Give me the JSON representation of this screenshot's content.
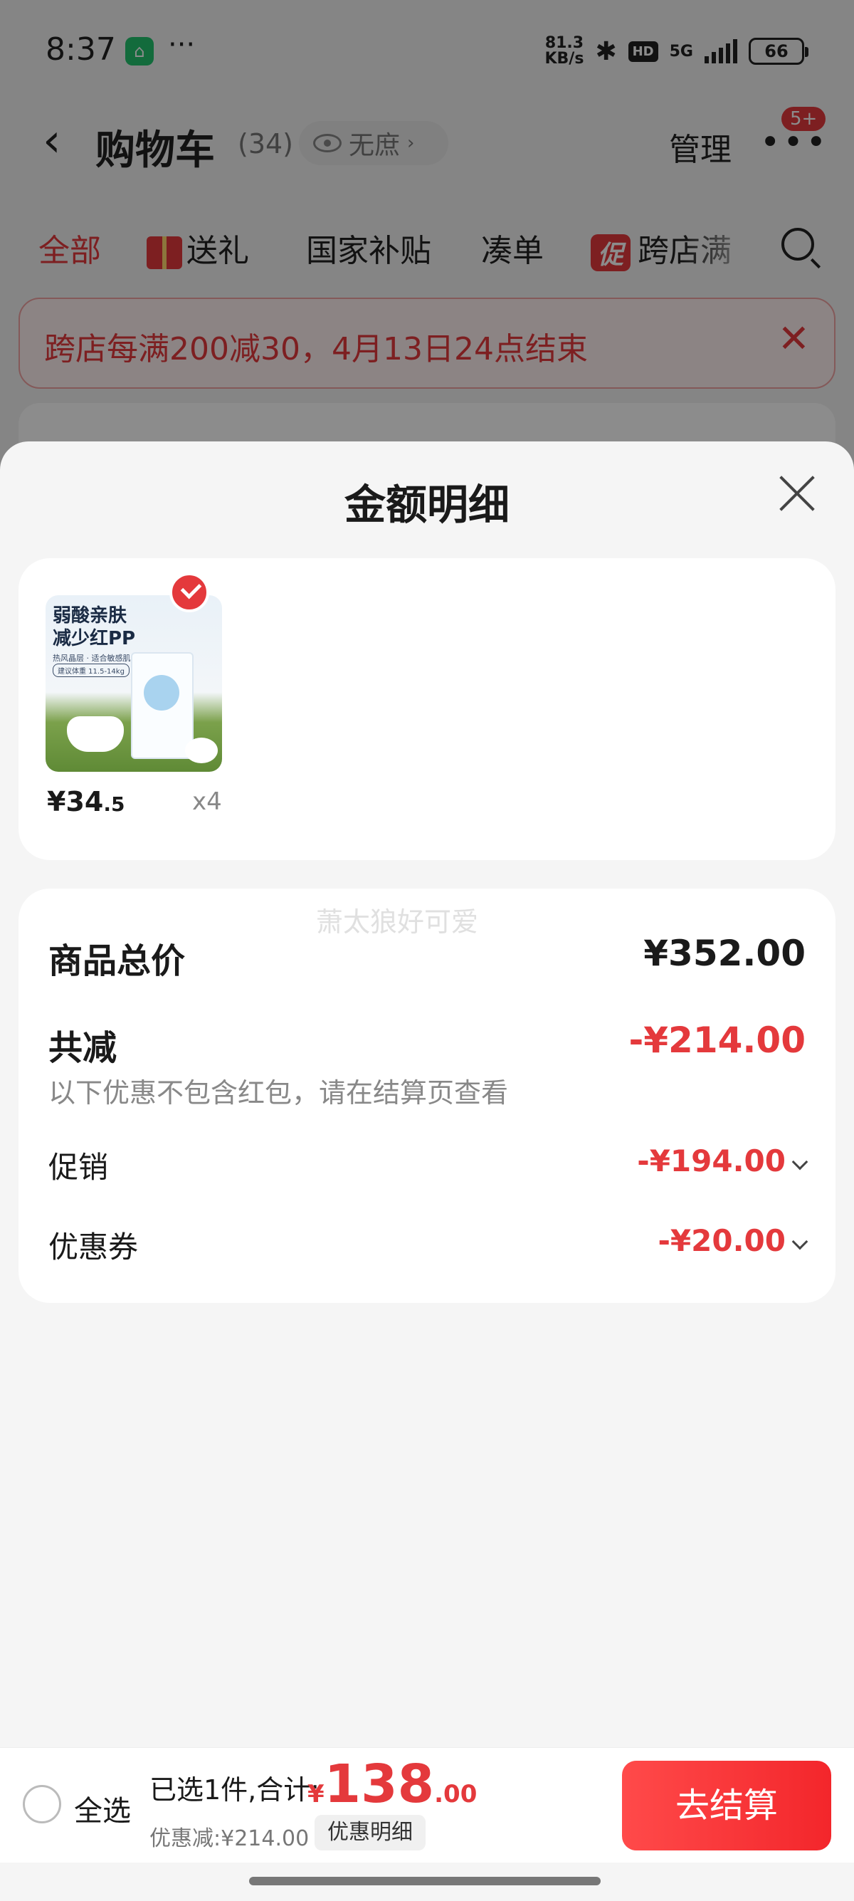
{
  "status_bar": {
    "time": "8:37",
    "dots": "···",
    "net_speed_line1": "81.3",
    "net_speed_line2": "KB/s",
    "hd": "HD",
    "network": "5G",
    "battery": "66"
  },
  "header": {
    "title": "购物车",
    "count": "(34)",
    "privacy_label": "无庶",
    "manage": "管理",
    "more_badge": "5+"
  },
  "tabs": [
    {
      "label": "全部"
    },
    {
      "label": "送礼"
    },
    {
      "label": "国家补贴"
    },
    {
      "label": "凑单"
    },
    {
      "label": "跨店满",
      "icon_text": "促"
    }
  ],
  "banner": {
    "text": "跨店每满200减30，4月13日24点结束",
    "close": "✕"
  },
  "sheet": {
    "title": "金额明细",
    "product": {
      "image_line1": "弱酸亲肤",
      "image_line2": "减少红PP",
      "image_sub": "热风晶层 · 适合敏感肌baby",
      "image_tag": "建议体重 11.5-14kg",
      "price_int": "¥34",
      "price_dec": ".5",
      "qty": "x4"
    },
    "watermark": "萧太狼好可爱",
    "total_label": "商品总价",
    "total_value": "¥352.00",
    "reduce_label": "共减",
    "reduce_value": "-¥214.00",
    "reduce_note": "以下优惠不包含红包，请在结算页查看",
    "promo_label": "促销",
    "promo_value": "-¥194.00",
    "coupon_label": "优惠券",
    "coupon_value": "-¥20.00"
  },
  "bottom_bar": {
    "select_all": "全选",
    "summary": "已选1件,合计:",
    "currency": "¥",
    "total_int": "138",
    "total_dec": ".00",
    "discount": "优惠减:¥214.00",
    "detail_button": "优惠明细",
    "checkout": "去结算"
  },
  "colors": {
    "accent": "#e4393c",
    "overlay": "rgba(0,0,0,0.45)"
  }
}
